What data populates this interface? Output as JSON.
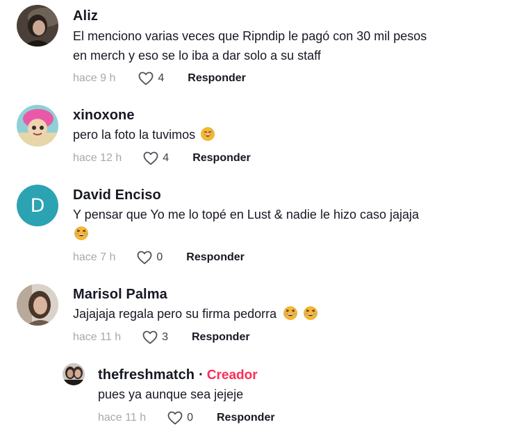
{
  "comments": [
    {
      "username": "Aliz",
      "text_lines": [
        "El menciono varias veces que Ripndip le pagó con 30 mil pesos",
        "en merch y eso se lo iba a dar solo a su staff"
      ],
      "timestamp": "hace 9 h",
      "likes": "4",
      "reply_label": "Responder",
      "avatar": "photo-avatar"
    },
    {
      "username": "xinoxone",
      "text_lines": [
        "pero la foto la tuvimos"
      ],
      "emoji": "grinning-sweat-emoji",
      "timestamp": "hace 12 h",
      "likes": "4",
      "reply_label": "Responder",
      "avatar": "cartoon-avatar"
    },
    {
      "username": "David Enciso",
      "avatar_letter": "D",
      "text_lines": [
        "Y pensar que Yo me lo topé en Lust & nadie le hizo caso jajaja"
      ],
      "emoji": "tears-of-joy-emoji",
      "timestamp": "hace 7 h",
      "likes": "0",
      "reply_label": "Responder",
      "avatar_color": "#2ba3b2"
    },
    {
      "username": "Marisol Palma",
      "text_lines": [
        "Jajajaja regala pero su firma pedorra"
      ],
      "emoji": "tears-of-joy-emoji",
      "timestamp": "hace 11 h",
      "likes": "3",
      "reply_label": "Responder",
      "avatar": "photo-avatar"
    }
  ],
  "reply": {
    "username": "thefreshmatch",
    "separator": "·",
    "badge": "Creador",
    "text": "pues ya aunque sea jejeje",
    "timestamp": "hace 11 h",
    "likes": "0",
    "reply_label": "Responder",
    "avatar": "photo-avatar"
  },
  "colors": {
    "text": "#161823",
    "muted": "#a6a8ae",
    "creator_badge": "#fe2c55",
    "letter_avatar": "#2ba3b2"
  }
}
